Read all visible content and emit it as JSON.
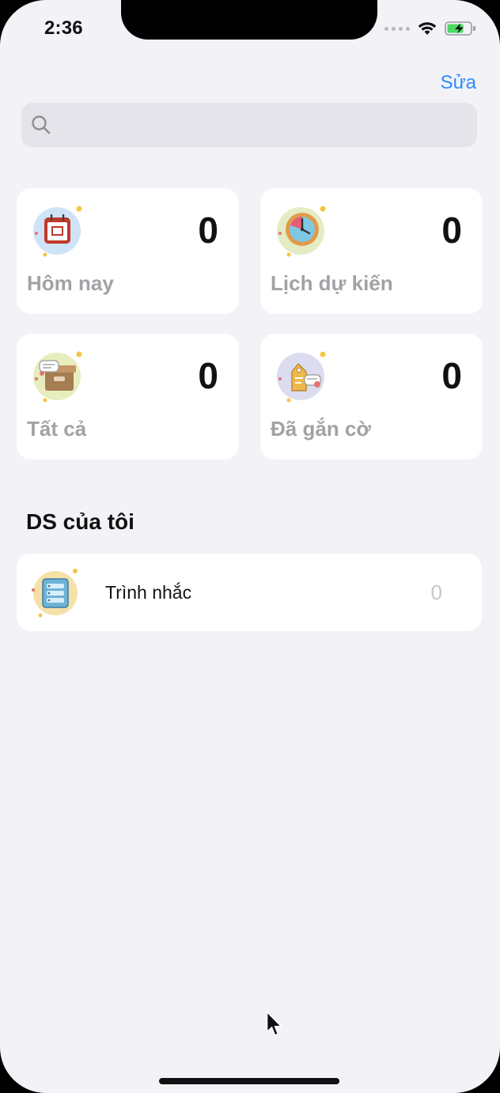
{
  "status_bar": {
    "time": "2:36"
  },
  "header": {
    "edit_label": "Sửa"
  },
  "search": {
    "placeholder": ""
  },
  "smart_lists": [
    {
      "label": "Hôm nay",
      "count": "0",
      "icon": "calendar-icon"
    },
    {
      "label": "Lịch dự kiến",
      "count": "0",
      "icon": "clock-icon"
    },
    {
      "label": "Tất cả",
      "count": "0",
      "icon": "inbox-box-icon"
    },
    {
      "label": "Đã gắn cờ",
      "count": "0",
      "icon": "tag-icon"
    }
  ],
  "my_lists": {
    "title": "DS của tôi",
    "items": [
      {
        "name": "Trình nhắc",
        "count": "0",
        "icon": "list-icon"
      }
    ]
  },
  "colors": {
    "accent": "#2f8cff",
    "background": "#f2f2f7",
    "card": "#ffffff",
    "muted_label": "#a2a2a6"
  }
}
